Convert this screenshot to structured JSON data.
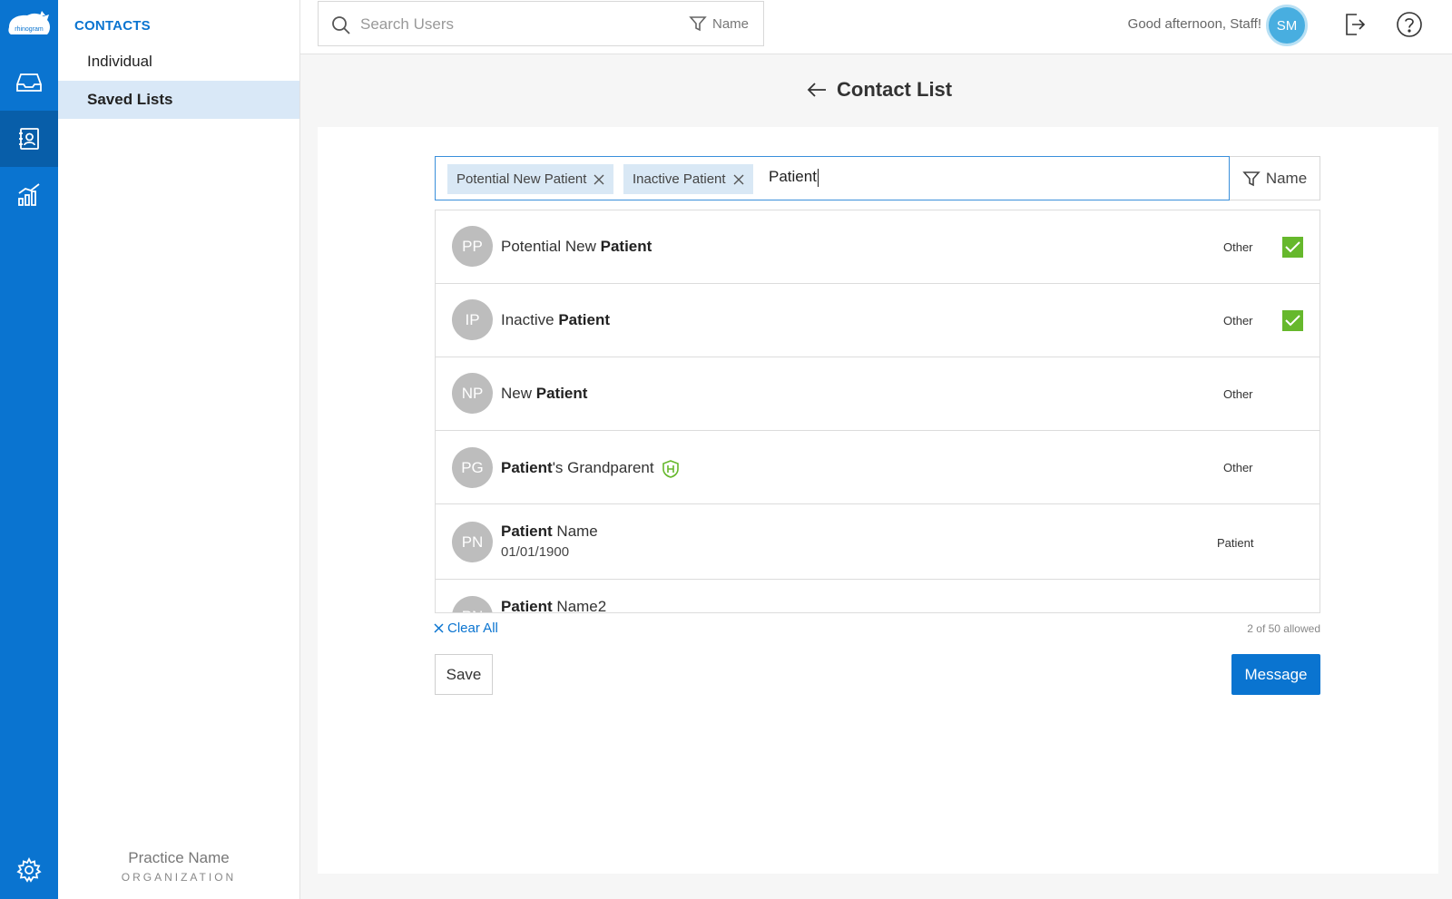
{
  "app": {
    "logo_text": "rhinogram"
  },
  "sidebar": {
    "section_title": "CONTACTS",
    "items": [
      {
        "label": "Individual",
        "active": false
      },
      {
        "label": "Saved Lists",
        "active": true
      }
    ],
    "practice_name": "Practice Name",
    "organization_label": "ORGANIZATION"
  },
  "topbar": {
    "search_placeholder": "Search Users",
    "filter_label": "Name",
    "greeting": "Good afternoon, Staff!",
    "user_initials": "SM"
  },
  "page": {
    "title": "Contact List"
  },
  "selector": {
    "tags": [
      {
        "label": "Potential New Patient"
      },
      {
        "label": "Inactive Patient"
      }
    ],
    "query": "Patient",
    "filter_label": "Name"
  },
  "results": [
    {
      "initials": "PP",
      "name_plain_before": "Potential New ",
      "name_bold": "Patient",
      "name_plain_after": "",
      "subtext": "",
      "type": "Other",
      "selected": true,
      "hipaa": false
    },
    {
      "initials": "IP",
      "name_plain_before": "Inactive ",
      "name_bold": "Patient",
      "name_plain_after": "",
      "subtext": "",
      "type": "Other",
      "selected": true,
      "hipaa": false
    },
    {
      "initials": "NP",
      "name_plain_before": "New ",
      "name_bold": "Patient",
      "name_plain_after": "",
      "subtext": "",
      "type": "Other",
      "selected": false,
      "hipaa": false
    },
    {
      "initials": "PG",
      "name_plain_before": "",
      "name_bold": "Patient",
      "name_plain_after": "'s Grandparent",
      "subtext": "",
      "type": "Other",
      "selected": false,
      "hipaa": true
    },
    {
      "initials": "PN",
      "name_plain_before": "",
      "name_bold": "Patient",
      "name_plain_after": " Name",
      "subtext": "01/01/1900",
      "type": "Patient",
      "selected": false,
      "hipaa": false
    },
    {
      "initials": "PN",
      "name_plain_before": "",
      "name_bold": "Patient",
      "name_plain_after": " Name2",
      "subtext": "",
      "type": "",
      "selected": false,
      "hipaa": false
    }
  ],
  "footer": {
    "clear_all_label": "Clear All",
    "allowed_text": "2 of 50 allowed",
    "save_label": "Save",
    "message_label": "Message"
  },
  "colors": {
    "brand_blue": "#0a74d0",
    "check_green": "#66b82c",
    "tag_bg": "#d9e8f5",
    "avatar_grey": "#bdbdbd"
  }
}
